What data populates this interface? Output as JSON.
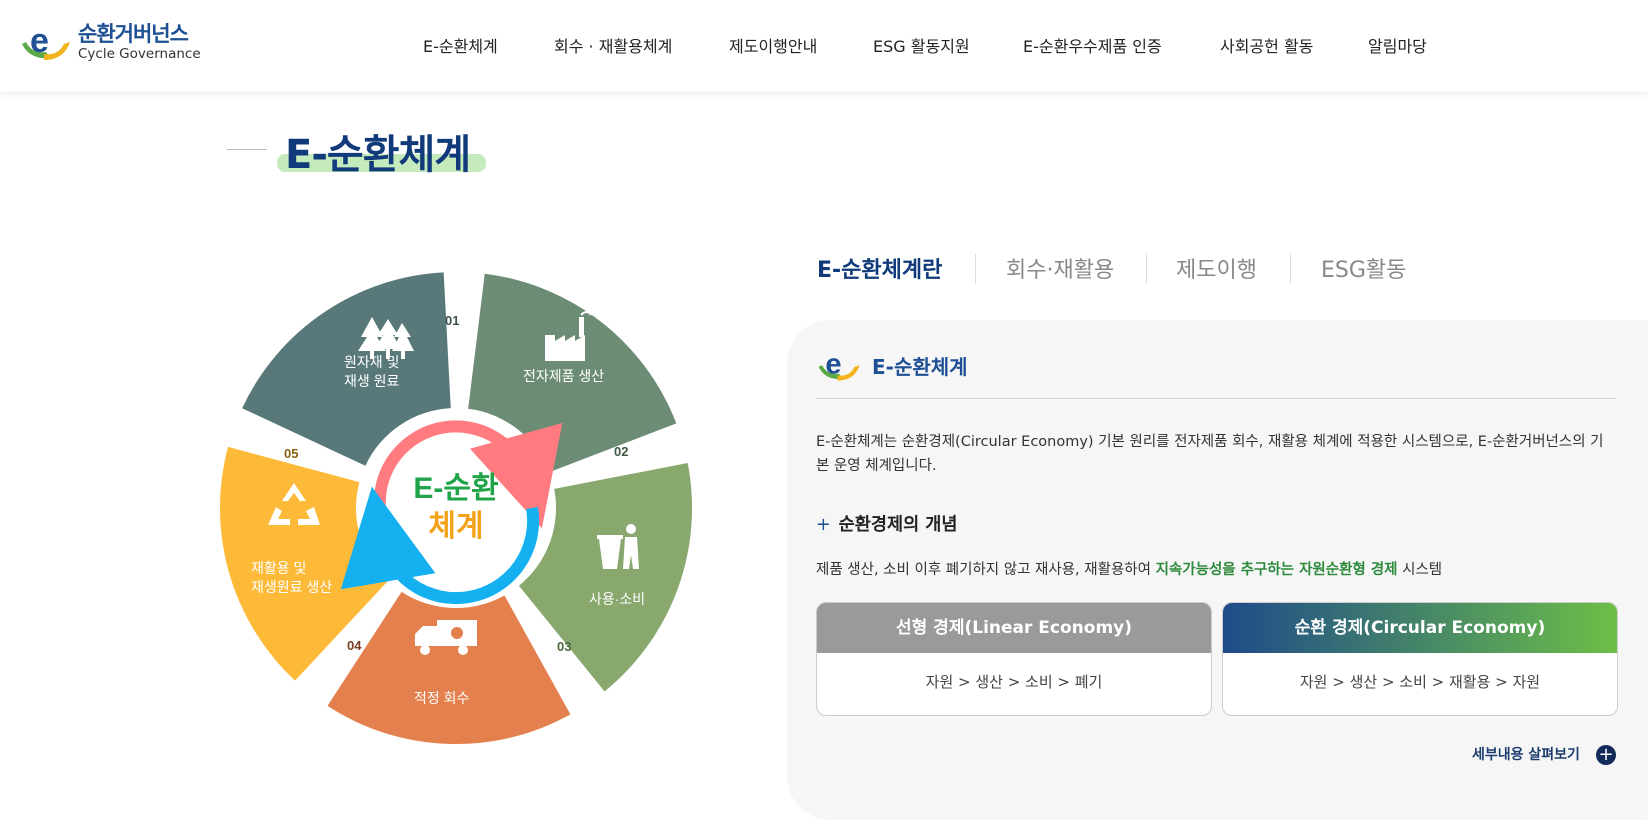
{
  "header": {
    "logo": {
      "ko": "순환거버넌스",
      "en": "Cycle Governance"
    },
    "nav": [
      {
        "label": "E-순환체계"
      },
      {
        "label": "회수 · 재활용체계"
      },
      {
        "label": "제도이행안내"
      },
      {
        "label": "ESG 활동지원"
      },
      {
        "label": "E-순환우수제품 인증"
      },
      {
        "label": "사회공헌 활동"
      },
      {
        "label": "알림마당"
      }
    ]
  },
  "page_title": "E-순환체계",
  "cycle": {
    "center_line1": "E-순환",
    "center_line2": "체계",
    "steps": [
      {
        "num": "01",
        "line1": "원자재 및",
        "line2": "재생 원료",
        "color": "#587879"
      },
      {
        "num": "02",
        "line1": "전자제품 생산",
        "line2": "",
        "color": "#6c8c75"
      },
      {
        "num": "03",
        "line1": "사용·소비",
        "line2": "",
        "color": "#88a86e"
      },
      {
        "num": "04",
        "line1": "적정 회수",
        "line2": "",
        "color": "#e3804e"
      },
      {
        "num": "05",
        "line1": "재활용 및",
        "line2": "재생원료 생산",
        "color": "#fdb938"
      }
    ]
  },
  "tabs": [
    {
      "label": "E-순환체계란"
    },
    {
      "label": "회수·재활용"
    },
    {
      "label": "제도이행"
    },
    {
      "label": "ESG활동"
    }
  ],
  "panel": {
    "title": "E-순환체계",
    "description": "E-순환체계는 순환경제(Circular Economy) 기본 원리를 전자제품 회수, 재활용 체계에 적용한 시스템으로, E-순환거버넌스의 기본 운영 체계입니다.",
    "concept_title": "순환경제의 개념",
    "concept_desc_before": "제품 생산, 소비 이후 폐기하지 않고 재사용, 재활용하여 ",
    "concept_desc_highlight": "지속가능성을 추구하는 자원순환형 경제",
    "concept_desc_after": " 시스템",
    "linear": {
      "title": "선형 경제(Linear Economy)",
      "flow": "자원 > 생산 > 소비 > 폐기"
    },
    "circular": {
      "title": "순환 경제(Circular Economy)",
      "flow": "자원 > 생산 > 소비 > 재활용 > 자원"
    },
    "more_label": "세부내용 살펴보기"
  },
  "colors": {
    "navy": "#103a7a",
    "green": "#2c8a3c",
    "linear_head": "#9a9a9a",
    "circular_start": "#1e4b8a",
    "circular_end": "#6cbf47"
  }
}
